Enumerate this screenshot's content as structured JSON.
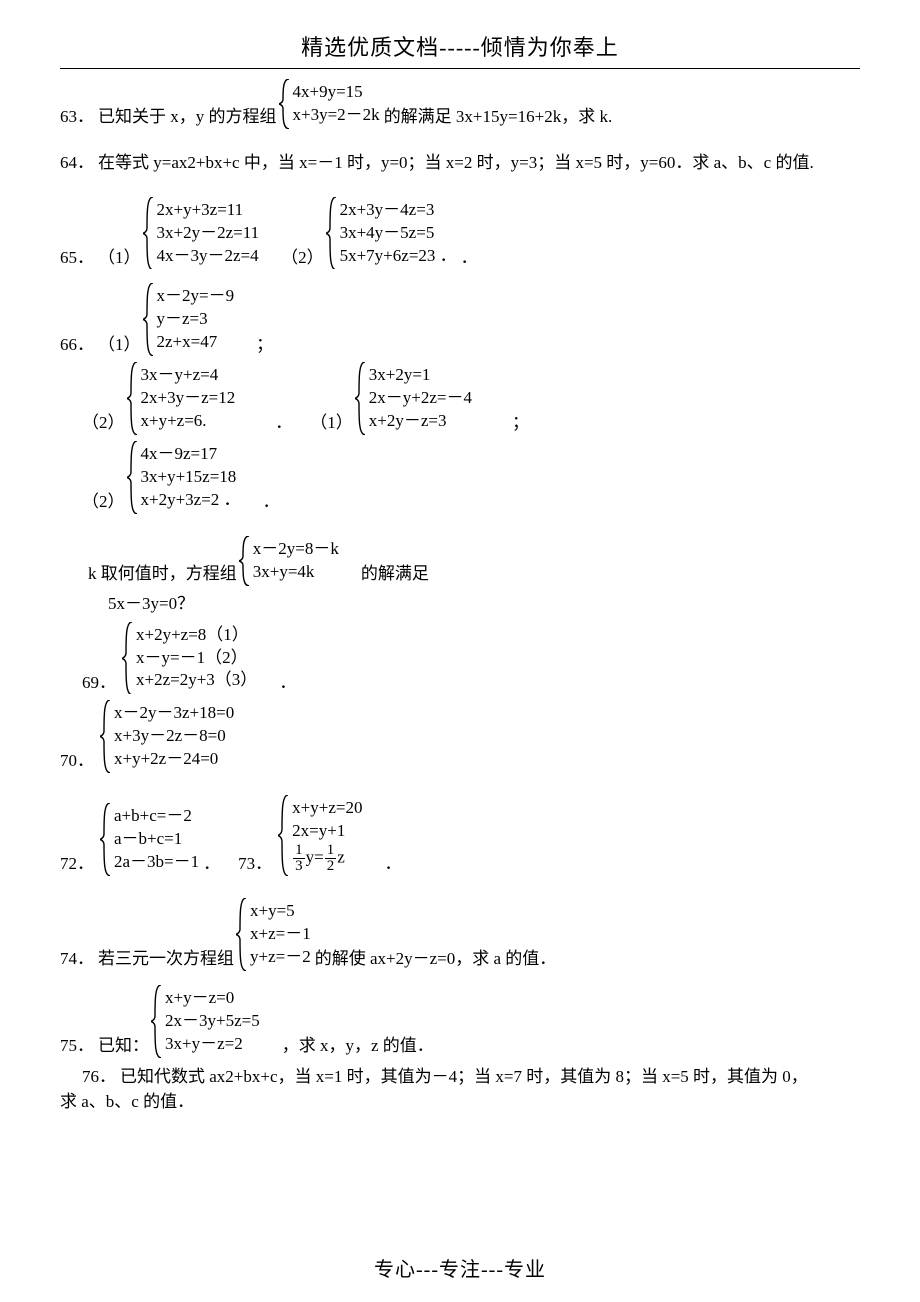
{
  "header": "精选优质文档-----倾情为你奉上",
  "footer": "专心---专注---专业",
  "q63": {
    "num": "63．",
    "pre": "已知关于 x，y 的方程组",
    "sys": [
      "4x+9y=15",
      "x+3y=2－2k"
    ],
    "post": "的解满足 3x+15y=16+2k，求 k."
  },
  "q64": {
    "num": "64．",
    "text": "在等式 y=ax2+bx+c 中，当 x=－1 时，y=0；当 x=2 时，y=3；当 x=5 时，y=60．求 a、b、c 的值."
  },
  "q65": {
    "num": "65．",
    "p1": "（1）",
    "sys1": [
      "2x+y+3z=11",
      "3x+2y－2z=11",
      "4x－3y－2z=4"
    ],
    "p2": "（2）",
    "sys2": [
      "2x+3y－4z=3",
      "3x+4y－5z=5",
      "5x+7y+6z=23 ．"
    ],
    "tail": "．"
  },
  "q66": {
    "num": "66．",
    "p1": "（1）",
    "sys1": [
      "x－2y=－9",
      "y－z=3",
      "2z+x=47"
    ],
    "semi": "；"
  },
  "q66b": {
    "p2": "（2）",
    "sys2": [
      "3x－y+z=4",
      "2x+3y－z=12",
      "x+y+z=6."
    ],
    "mid": "．",
    "p1b": "（1）",
    "sys3": [
      "3x+2y=1",
      "2x－y+2z=－4",
      "x+2y－z=3"
    ],
    "semi": "；"
  },
  "q67b": {
    "p2": "（2）",
    "sys": [
      "4x－9z=17",
      "3x+y+15z=18",
      "x+2y+3z=2 ．"
    ],
    "tail": "．"
  },
  "q68": {
    "pre": "k 取何值时，方程组",
    "sys": [
      "x－2y=8－k",
      "3x+y=4k"
    ],
    "post": "的解满足",
    "line2": "5x－3y=0？"
  },
  "q69": {
    "num": "69．",
    "sys": [
      "x+2y+z=8（1）",
      "x－y=－1（2）",
      "x+2z=2y+3（3）"
    ],
    "tail": "．"
  },
  "q70": {
    "num": "70．",
    "sys": [
      "x－2y－3z+18=0",
      "x+3y－2z－8=0",
      "x+y+2z－24=0"
    ]
  },
  "q72": {
    "num": "72．",
    "sys": [
      "a+b+c=－2",
      "a－b+c=1",
      "2a－3b=－1"
    ],
    "tail": "．"
  },
  "q73": {
    "num": "73．",
    "sys_l1": "x+y+z=20",
    "sys_l2": "2x=y+1",
    "frac1_n": "1",
    "frac1_d": "3",
    "mid": "y=",
    "frac2_n": "1",
    "frac2_d": "2",
    "end": "z",
    "tail": "．"
  },
  "q74": {
    "num": "74．",
    "pre": "若三元一次方程组",
    "sys": [
      "x+y=5",
      "x+z=－1",
      "y+z=－2"
    ],
    "post": "的解使 ax+2y－z=0，求 a 的值．"
  },
  "q75": {
    "num": "75．",
    "pre": "已知：",
    "sys": [
      "x+y－z=0",
      "2x－3y+5z=5",
      "3x+y－z=2"
    ],
    "post": "，求 x，y，z 的值．"
  },
  "q76": {
    "num": "76．",
    "l1": "已知代数式 ax2+bx+c，当 x=1 时，其值为－4；当 x=7 时，其值为 8；当 x=5 时，其值为 0，",
    "l2": "求 a、b、c 的值．"
  }
}
